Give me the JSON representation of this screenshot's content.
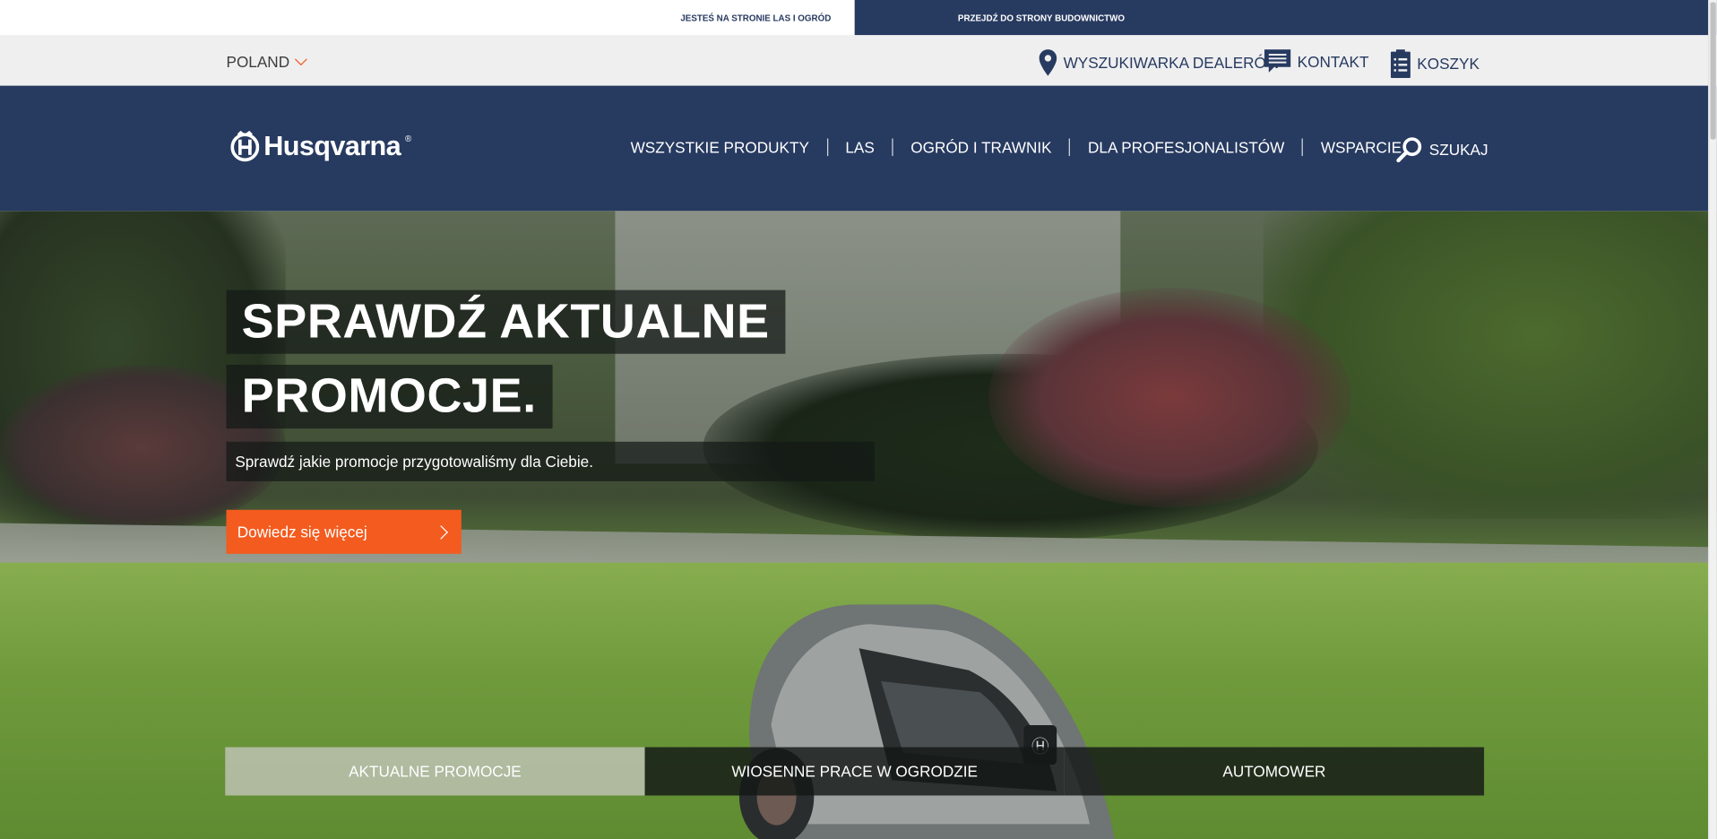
{
  "site_switch": {
    "current_label": "JESTEŚ NA STRONIE LAS I OGRÓD",
    "other_label": "PRZEJDŹ DO STRONY BUDOWNICTWO"
  },
  "util": {
    "country": "POLAND",
    "dealer": "WYSZUKIWARKA DEALERÓW",
    "contact": "KONTAKT",
    "cart": "KOSZYK"
  },
  "header": {
    "logo_text": "Husqvarna",
    "logo_reg": "®",
    "nav": [
      "WSZYSTKIE PRODUKTY",
      "LAS",
      "OGRÓD I TRAWNIK",
      "DLA PROFESJONALISTÓW",
      "WSPARCIE"
    ],
    "search_label": "SZUKAJ"
  },
  "hero": {
    "title_line1": "SPRAWDŹ AKTUALNE",
    "title_line2": "PROMOCJE.",
    "subtitle": "Sprawdź jakie promocje przygotowaliśmy dla Ciebie.",
    "cta": "Dowiedz się więcej",
    "tabs": [
      "AKTUALNE PROMOCJE",
      "WIOSENNE PRACE W OGRODZIE",
      "AUTOMOWER"
    ]
  },
  "colors": {
    "navy": "#273a60",
    "accent": "#f35b1f",
    "util_bg": "#efeff0"
  }
}
